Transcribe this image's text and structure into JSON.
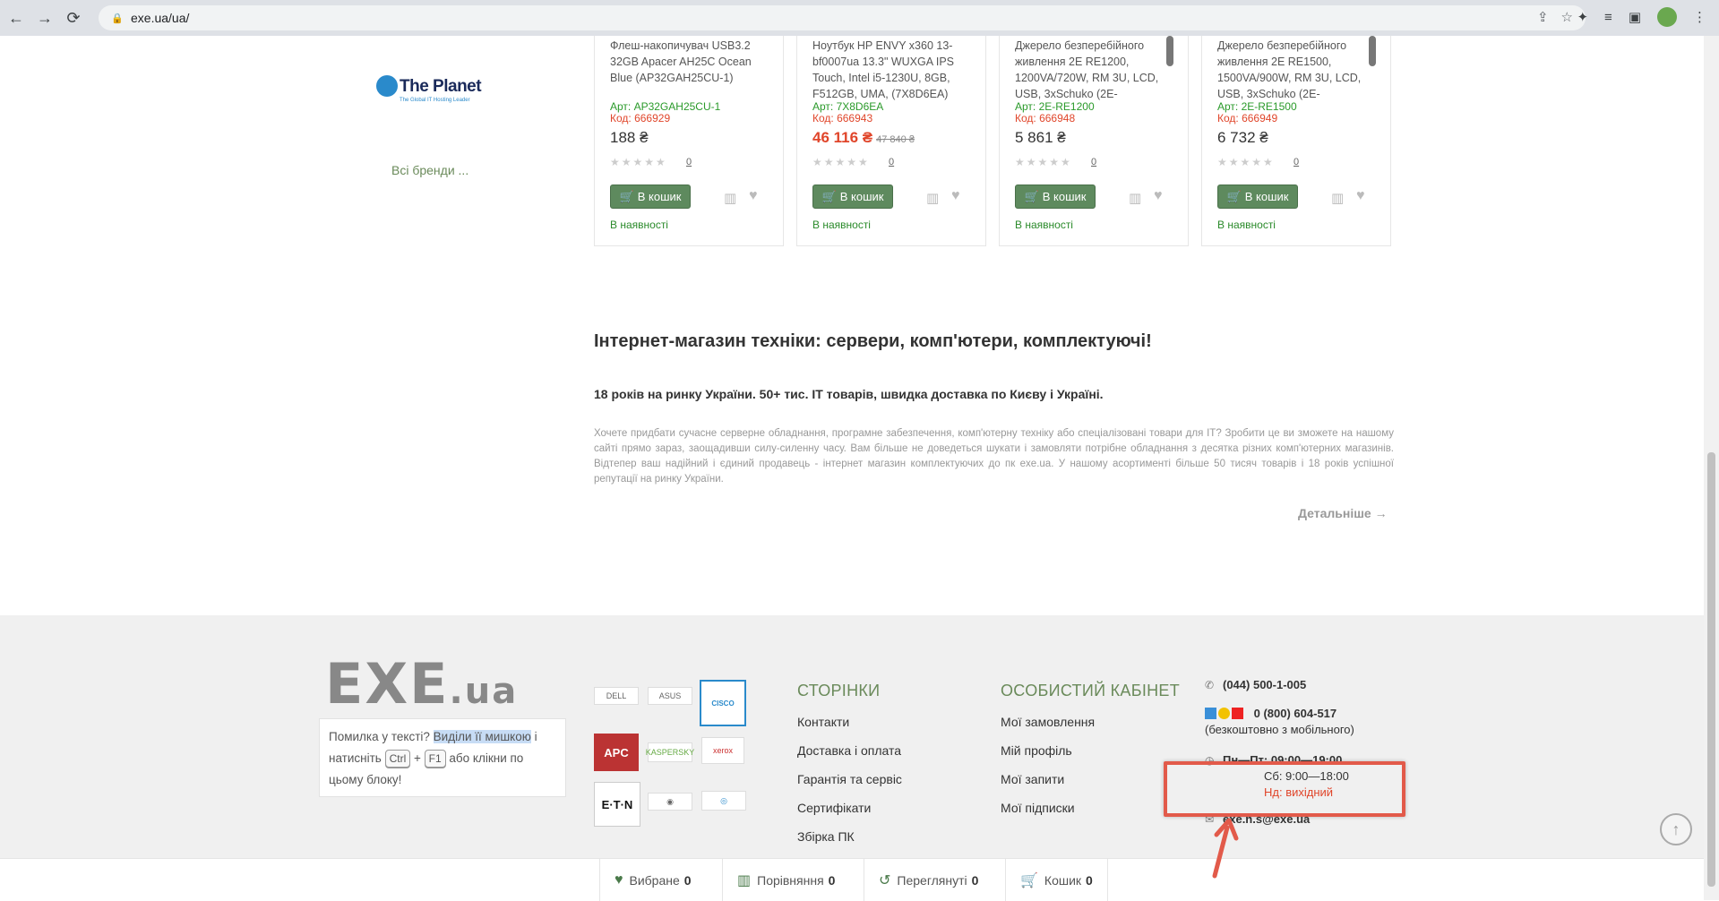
{
  "browser": {
    "url": "exe.ua/ua/"
  },
  "brands": {
    "logo_name": "The Planet",
    "logo_sub": "The Global IT Hosting Leader",
    "all_brands": "Всі бренди ..."
  },
  "products": [
    {
      "title": "Флеш-накопичувач USB3.2 32GB Apacer AH25C Ocean Blue (AP32GAH25CU-1)",
      "art": "Арт: AP32GAH25CU-1",
      "code": "Код: 666929",
      "price": "188 ₴",
      "old_price": "",
      "reviews": "0",
      "buy": "В кошик",
      "stock": "В наявності"
    },
    {
      "title": "Ноутбук HP ENVY x360 13-bf0007ua 13.3\" WUXGA IPS Touch, Intel i5-1230U, 8GB, F512GB, UMA, (7X8D6EA)",
      "art": "Арт: 7X8D6EA",
      "code": "Код: 666943",
      "price": "46 116 ₴",
      "old_price": "47 840 ₴",
      "reviews": "0",
      "buy": "В кошик",
      "stock": "В наявності"
    },
    {
      "title": "Джерело безперебійного живлення 2E RE1200, 1200VA/720W, RM 3U, LCD, USB, 3xSchuko (2E-",
      "art": "Арт: 2E-RE1200",
      "code": "Код: 666948",
      "price": "5 861 ₴",
      "old_price": "",
      "reviews": "0",
      "buy": "В кошик",
      "stock": "В наявності"
    },
    {
      "title": "Джерело безперебійного живлення 2E RE1500, 1500VA/900W, RM 3U, LCD, USB, 3xSchuko (2E-",
      "art": "Арт: 2E-RE1500",
      "code": "Код: 666949",
      "price": "6 732 ₴",
      "old_price": "",
      "reviews": "0",
      "buy": "В кошик",
      "stock": "В наявності"
    }
  ],
  "seo": {
    "title": "Інтернет-магазин техніки: сервери, комп'ютери, комплектуючі!",
    "subtitle": "18 років на ринку України. 50+ тис. IT товарів, швидка доставка по Києву і Україні.",
    "text": "Хочете придбати сучасне серверне обладнання, програмне забезпечення, комп'ютерну техніку або спеціалізовані товари для IT? Зробити це ви зможете на нашому сайті прямо зараз, заощадивши силу-силенну часу. Вам більше не доведеться шукати і замовляти потрібне обладнання з десятка різних комп'ютерних магазинів. Відтепер ваш надійний і єдиний продавець - інтернет магазин комплектуючих до пк exe.ua. У нашому асортименті більше 50 тисяч товарів і 18 років успішної репутації на ринку України.",
    "more": "Детальніше →"
  },
  "footer": {
    "logo_main": "EXE",
    "logo_suffix": ".ua",
    "error_box": {
      "t1": "Помилка у тексті? ",
      "highlight": "Виділи її мишкою",
      "t2": " і натисніть ",
      "key1": "Ctrl",
      "plus": " + ",
      "key2": "F1",
      "t3": " або клікни по цьому блоку!"
    },
    "partners": {
      "apc": "APC",
      "cisco": "CISCO",
      "eaton": "E·T·N",
      "kaspersky": "KASPERSKY",
      "xerox": "xerox",
      "asus": "ASUS",
      "dell": "DELL"
    },
    "pages_title": "СТОРІНКИ",
    "pages": [
      "Контакти",
      "Доставка і оплата",
      "Гарантія та сервіс",
      "Сертифікати",
      "Збірка ПК"
    ],
    "cabinet_title": "ОСОБИСТИЙ КАБІНЕТ",
    "cabinet": [
      "Мої замовлення",
      "Мій профіль",
      "Мої запити",
      "Мої підписки"
    ],
    "phone1": "(044) 500-1-005",
    "phone2": "0 (800) 604-517",
    "phone2_note": "(безкоштовно з мобільного)",
    "hours1": "Пн—Пт: 09:00—19:00",
    "hours2": "Сб: 9:00—18:00",
    "hours3": "Нд: вихідний",
    "email": "exe.n.s@exe.ua"
  },
  "bottom_bar": {
    "favorites": "Вибране",
    "favorites_count": "0",
    "compare": "Порівняння",
    "compare_count": "0",
    "viewed": "Переглянуті",
    "viewed_count": "0",
    "cart": "Кошик",
    "cart_count": "0"
  },
  "colors": {
    "accent_green": "#5e8a5e",
    "sale_red": "#e0452a",
    "annotation_red": "#e25a4a"
  }
}
